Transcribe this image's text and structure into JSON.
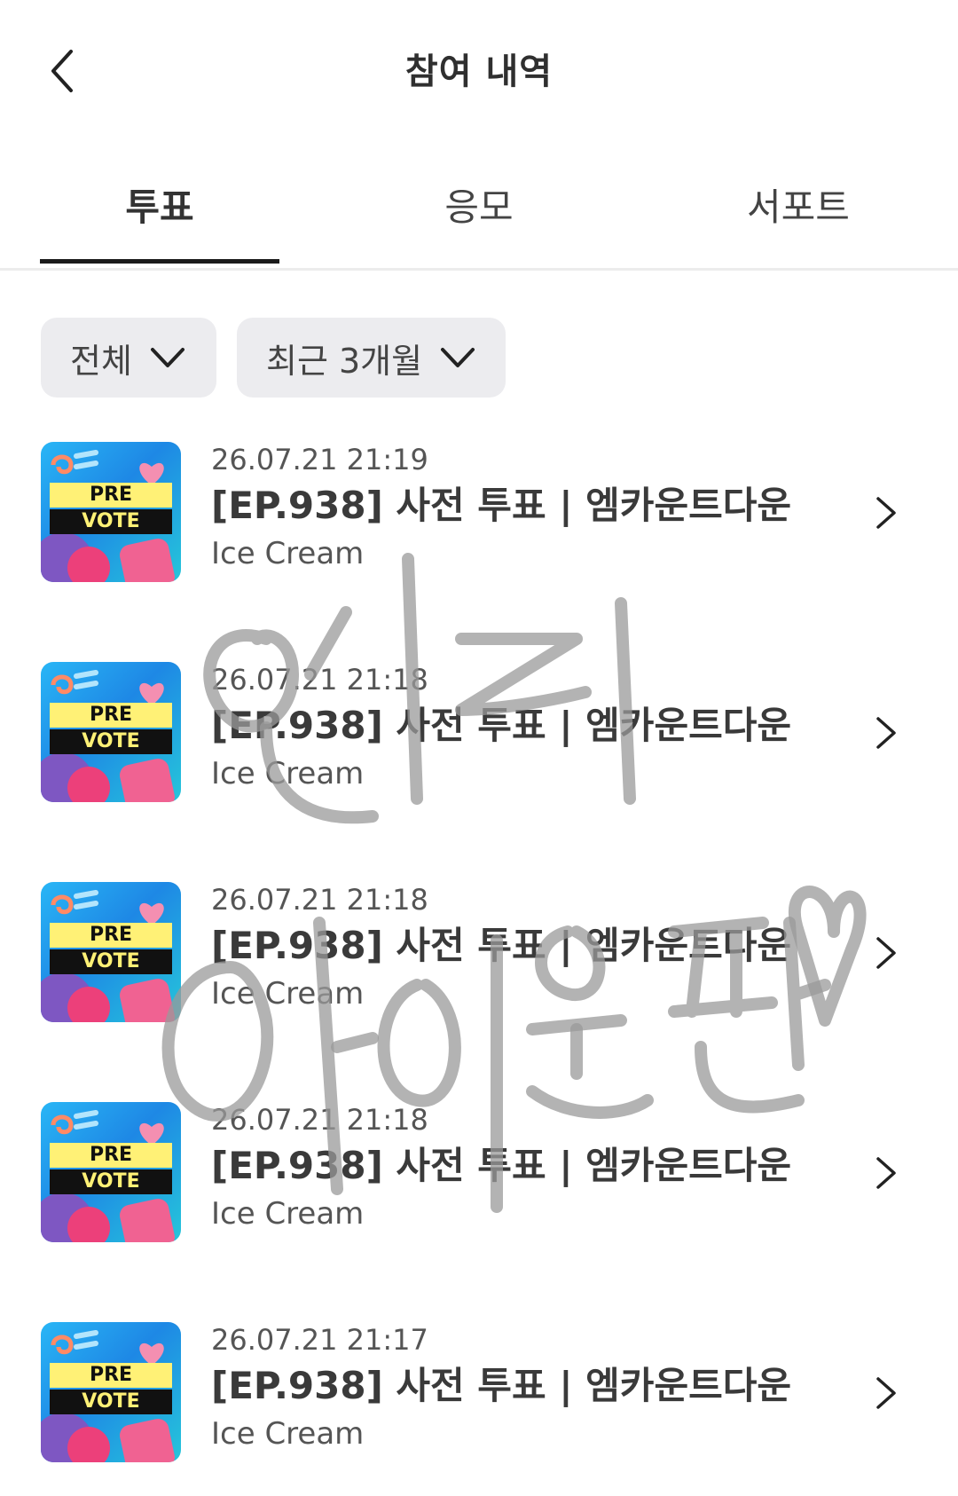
{
  "header": {
    "title": "참여 내역",
    "back_icon": "chevron-left-icon"
  },
  "tabs": [
    {
      "label": "투표",
      "active": true
    },
    {
      "label": "응모",
      "active": false
    },
    {
      "label": "서포트",
      "active": false
    }
  ],
  "filters": {
    "type": {
      "label": "전체",
      "icon": "chevron-down-icon"
    },
    "period": {
      "label": "최근 3개월",
      "icon": "chevron-down-icon"
    }
  },
  "items": [
    {
      "date": "26.07.21 21:19",
      "title": "[EP.938] 사전 투표 | 엠카운트다운",
      "subtitle": "Ice Cream",
      "thumb_line1": "PRE",
      "thumb_line2": "VOTE"
    },
    {
      "date": "26.07.21 21:18",
      "title": "[EP.938] 사전 투표 | 엠카운트다운",
      "subtitle": "Ice Cream",
      "thumb_line1": "PRE",
      "thumb_line2": "VOTE"
    },
    {
      "date": "26.07.21 21:18",
      "title": "[EP.938] 사전 투표 | 엠카운트다운",
      "subtitle": "Ice Cream",
      "thumb_line1": "PRE",
      "thumb_line2": "VOTE"
    },
    {
      "date": "26.07.21 21:18",
      "title": "[EP.938] 사전 투표 | 엠카운트다운",
      "subtitle": "Ice Cream",
      "thumb_line1": "PRE",
      "thumb_line2": "VOTE"
    },
    {
      "date": "26.07.21 21:17",
      "title": "[EP.938] 사전 투표 | 엠카운트다운",
      "subtitle": "Ice Cream",
      "thumb_line1": "PRE",
      "thumb_line2": "VOTE"
    }
  ],
  "watermark": {
    "line1": "엔티",
    "line2": "아이원팬",
    "color": "#9a9a9a"
  },
  "colors": {
    "tab_underline": "#1a1a1a",
    "filter_bg": "#ececef",
    "divider": "#ececec"
  }
}
